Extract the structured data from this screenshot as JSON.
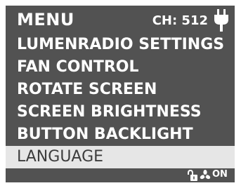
{
  "header": {
    "title": "MENU",
    "channel": "CH: 512",
    "power_icon": "plug-icon"
  },
  "menu": {
    "items": [
      {
        "label": "LUMENRADIO SETTINGS",
        "selected": false
      },
      {
        "label": "FAN CONTROL",
        "selected": false
      },
      {
        "label": "ROTATE SCREEN",
        "selected": false
      },
      {
        "label": "SCREEN BRIGHTNESS",
        "selected": false
      },
      {
        "label": "BUTTON BACKLIGHT",
        "selected": false
      },
      {
        "label": "LANGUAGE",
        "selected": true
      }
    ]
  },
  "footer": {
    "lock_icon": "unlock-icon",
    "fan_icon": "fan-icon",
    "fan_status": "ON"
  },
  "colors": {
    "background": "#525252",
    "text": "#ffffff",
    "selected_background": "#e6e6e6",
    "selected_text": "#3c3c3c"
  }
}
